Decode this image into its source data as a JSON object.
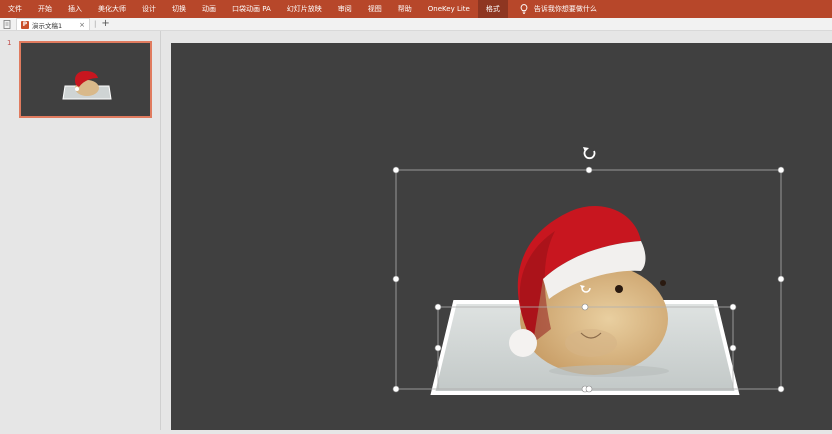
{
  "ribbon": {
    "tabs": [
      "文件",
      "开始",
      "插入",
      "美化大师",
      "设计",
      "切换",
      "动画",
      "口袋动画 PA",
      "幻灯片放映",
      "审阅",
      "视图",
      "帮助",
      "OneKey Lite",
      "格式"
    ],
    "active_tab": "格式",
    "tell_me": "告诉我你想要做什么"
  },
  "document": {
    "tab_name": "演示文稿1",
    "close": "×",
    "new_tab": "+"
  },
  "thumbnails": {
    "slide_number": "1"
  },
  "colors": {
    "ribbon_bg": "#b7472a",
    "slide_bg": "#404040",
    "thumb_border": "#e07b5f",
    "hat_red": "#c8161f"
  },
  "icons": {
    "rotate": "rotate-handle-icon",
    "lightbulb": "lightbulb-icon"
  }
}
